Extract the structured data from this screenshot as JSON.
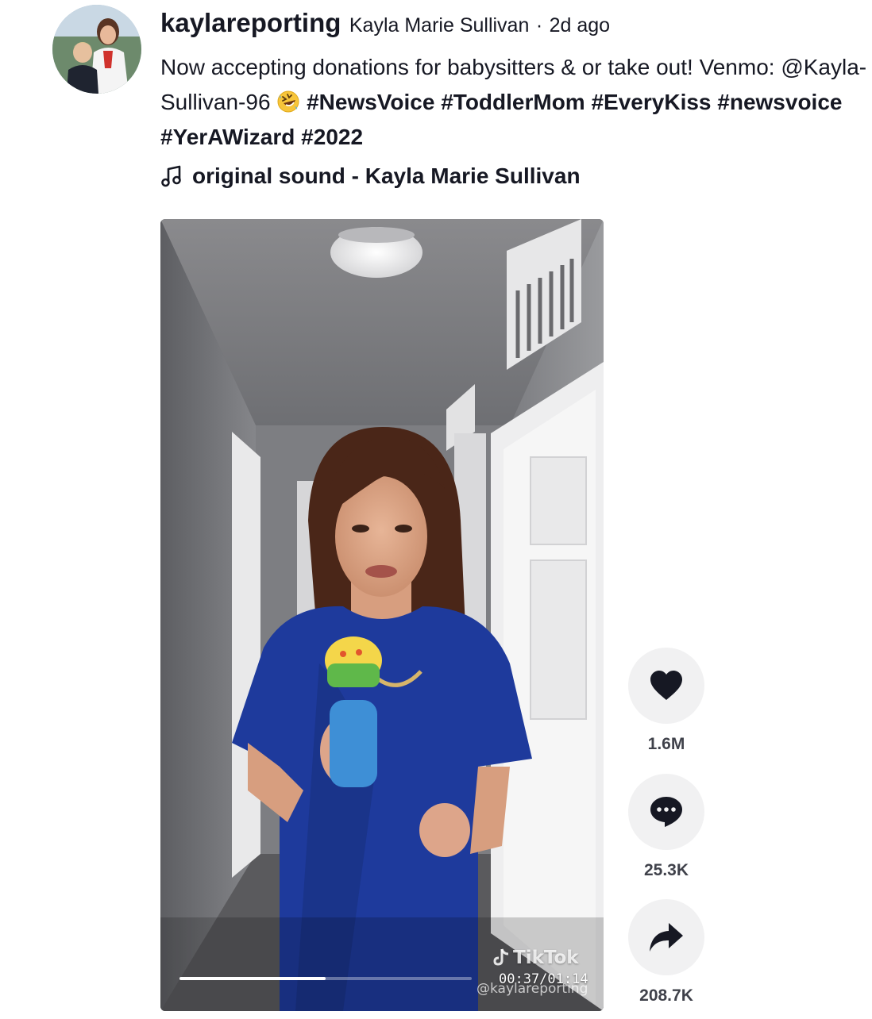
{
  "post": {
    "username": "kaylareporting",
    "display_name": "Kayla Marie Sullivan",
    "separator": "·",
    "time_ago": "2d ago",
    "caption_text_1": "Now accepting donations for babysitters & or take out! Venmo: @Kayla-Sullivan-96",
    "caption_emoji": "rolling-on-floor-laughing-emoji",
    "hashtags": [
      "#NewsVoice",
      "#ToddlerMom",
      "#EveryKiss",
      "#newsvoice",
      "#YerAWizard",
      "#2022"
    ],
    "sound_label": "original sound - Kayla Marie Sullivan",
    "sound_icon": "music-note-icon"
  },
  "video": {
    "progress": 0.5,
    "current_time": "00:37",
    "duration": "01:14",
    "time_display": "00:37/01:14",
    "watermark_logo": "TikTok",
    "watermark_handle": "@kaylareporting"
  },
  "actions": {
    "like": {
      "icon": "heart-icon",
      "count": "1.6M"
    },
    "comment": {
      "icon": "comment-bubble-icon",
      "count": "25.3K"
    },
    "share": {
      "icon": "share-arrow-icon",
      "count": "208.7K"
    }
  },
  "colors": {
    "text": "#161823",
    "action_bg": "#f1f1f2",
    "dress": "#1e3a9c"
  }
}
